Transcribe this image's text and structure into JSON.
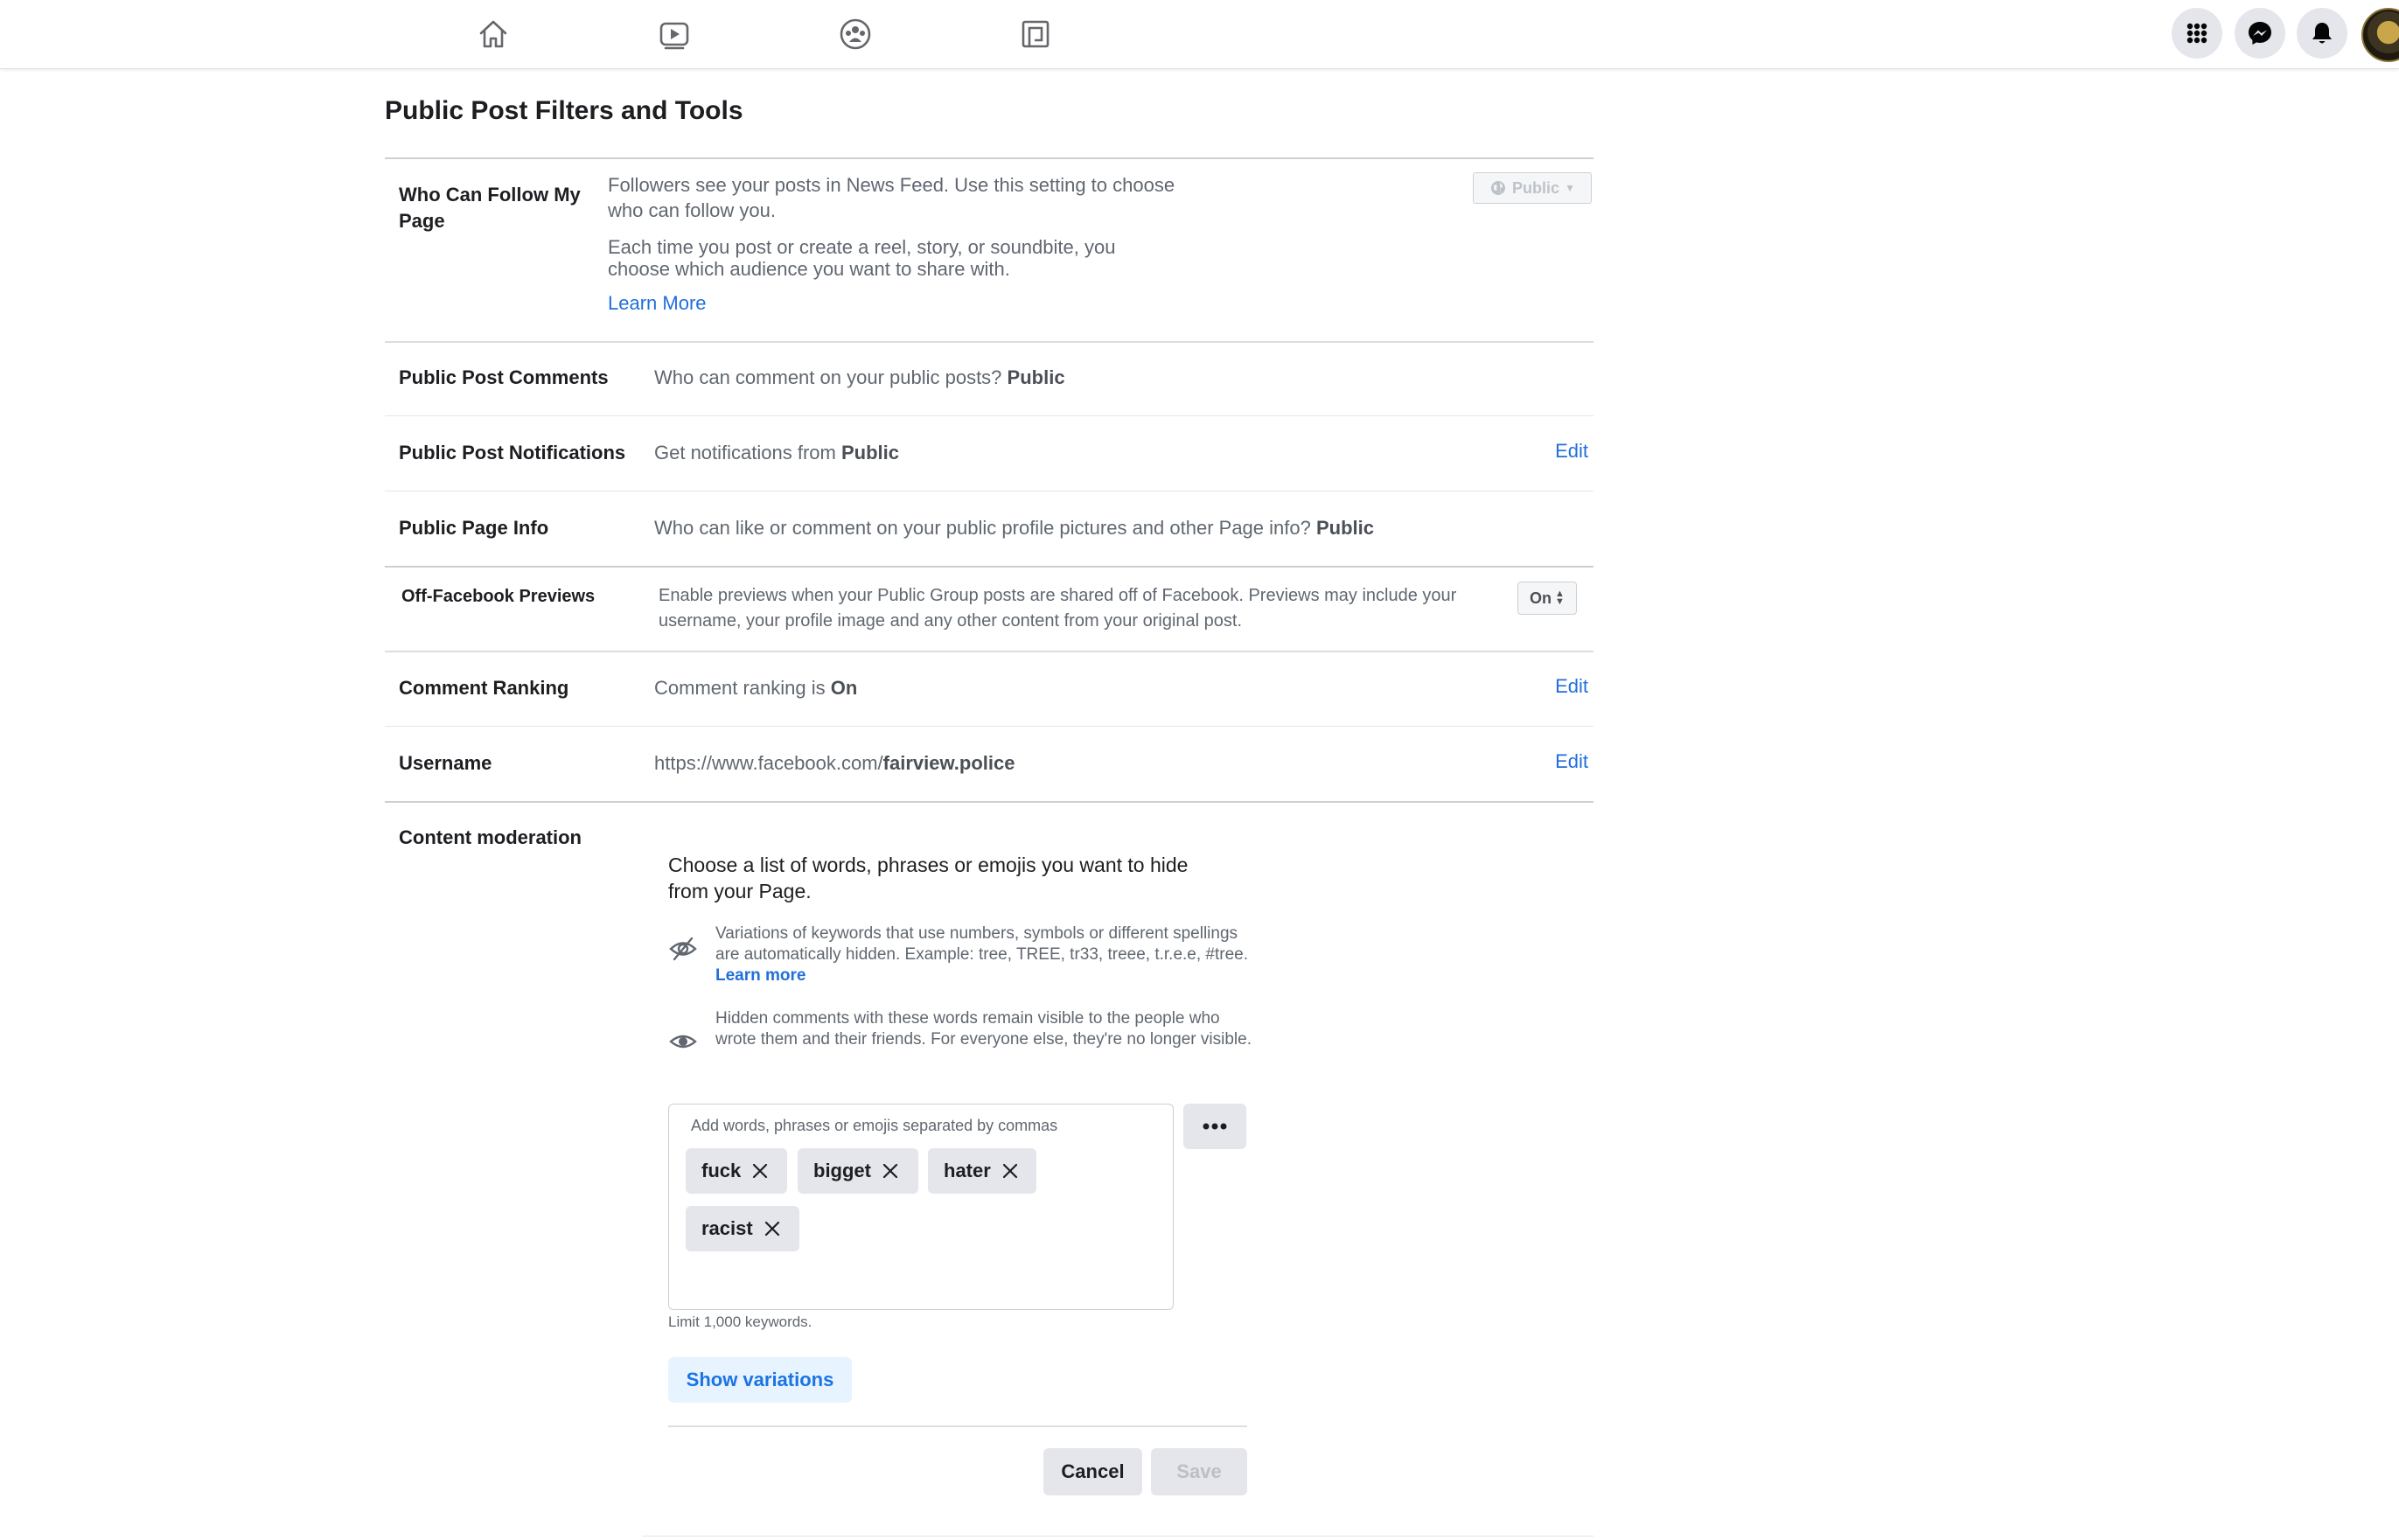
{
  "nav": {
    "icons": [
      "home-icon",
      "watch-icon",
      "groups-icon",
      "gaming-icon"
    ],
    "right_icons": [
      "menu-grid-icon",
      "messenger-icon",
      "notifications-icon"
    ]
  },
  "page": {
    "title": "Public Post Filters and Tools"
  },
  "follow": {
    "label": "Who Can Follow My Page",
    "desc1": "Followers see your posts in News Feed. Use this setting to choose who can follow you.",
    "desc2": "Each time you post or create a reel, story, or soundbite, you choose which audience you want to share with.",
    "learn_more": "Learn More",
    "audience": "Public"
  },
  "comments": {
    "label": "Public Post Comments",
    "question": "Who can comment on your public posts?",
    "value": "Public"
  },
  "notifications": {
    "label": "Public Post Notifications",
    "prefix": "Get notifications from",
    "value": "Public",
    "edit": "Edit"
  },
  "page_info": {
    "label": "Public Page Info",
    "question": "Who can like or comment on your public profile pictures and other Page info?",
    "value": "Public"
  },
  "previews": {
    "label": "Off-Facebook Previews",
    "desc": "Enable previews when your Public Group posts are shared off of Facebook. Previews may include your username, your profile image and any other content from your original post.",
    "value": "On"
  },
  "ranking": {
    "label": "Comment Ranking",
    "prefix": "Comment ranking is",
    "value": "On",
    "edit": "Edit"
  },
  "username": {
    "label": "Username",
    "prefix": "https://www.facebook.com/",
    "value": "fairview.police",
    "edit": "Edit"
  },
  "moderation": {
    "label": "Content moderation",
    "heading": "Choose a list of words, phrases or emojis you want to hide from your Page.",
    "info1": "Variations of keywords that use numbers, symbols or different spellings are automatically hidden. Example: tree, TREE, tr33, treee, t.r.e.e, #tree.",
    "info1_link": "Learn more",
    "info2": "Hidden comments with these words remain visible to the people who wrote them and their friends. For everyone else, they're no longer visible.",
    "placeholder": "Add words, phrases or emojis separated by commas",
    "keywords": [
      "fuck",
      "bigget",
      "hater",
      "racist"
    ],
    "limit": "Limit 1,000 keywords.",
    "show_variations": "Show variations",
    "cancel": "Cancel",
    "save": "Save"
  }
}
